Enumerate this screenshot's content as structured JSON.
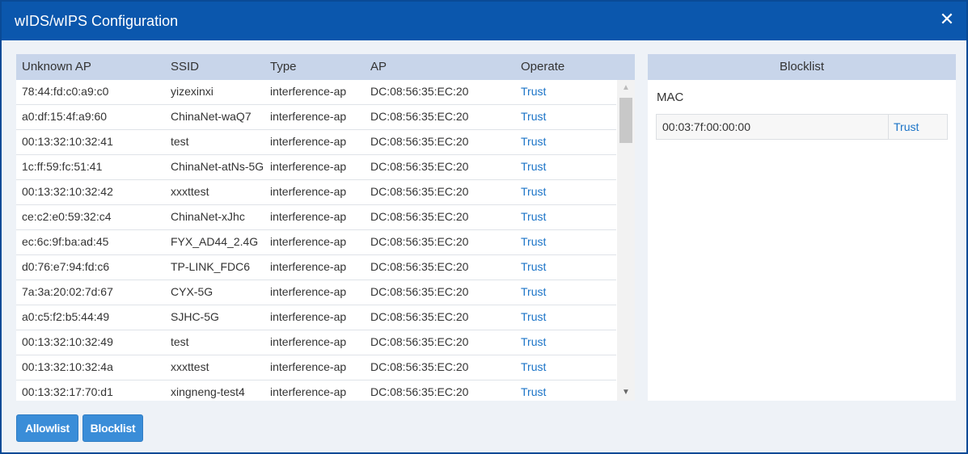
{
  "dialog": {
    "title": "wIDS/wIPS Configuration",
    "close_icon": "close-icon"
  },
  "table": {
    "columns": [
      "Unknown AP",
      "SSID",
      "Type",
      "AP",
      "Operate"
    ],
    "rows": [
      {
        "mac": "78:44:fd:c0:a9:c0",
        "ssid": "yizexinxi",
        "type": "interference-ap",
        "ap": "DC:08:56:35:EC:20",
        "operate": "Trust"
      },
      {
        "mac": "a0:df:15:4f:a9:60",
        "ssid": "ChinaNet-waQ7",
        "type": "interference-ap",
        "ap": "DC:08:56:35:EC:20",
        "operate": "Trust"
      },
      {
        "mac": "00:13:32:10:32:41",
        "ssid": "test",
        "type": "interference-ap",
        "ap": "DC:08:56:35:EC:20",
        "operate": "Trust"
      },
      {
        "mac": "1c:ff:59:fc:51:41",
        "ssid": "ChinaNet-atNs-5G",
        "type": "interference-ap",
        "ap": "DC:08:56:35:EC:20",
        "operate": "Trust"
      },
      {
        "mac": "00:13:32:10:32:42",
        "ssid": "xxxttest",
        "type": "interference-ap",
        "ap": "DC:08:56:35:EC:20",
        "operate": "Trust"
      },
      {
        "mac": "ce:c2:e0:59:32:c4",
        "ssid": "ChinaNet-xJhc",
        "type": "interference-ap",
        "ap": "DC:08:56:35:EC:20",
        "operate": "Trust"
      },
      {
        "mac": "ec:6c:9f:ba:ad:45",
        "ssid": "FYX_AD44_2.4G",
        "type": "interference-ap",
        "ap": "DC:08:56:35:EC:20",
        "operate": "Trust"
      },
      {
        "mac": "d0:76:e7:94:fd:c6",
        "ssid": "TP-LINK_FDC6",
        "type": "interference-ap",
        "ap": "DC:08:56:35:EC:20",
        "operate": "Trust"
      },
      {
        "mac": "7a:3a:20:02:7d:67",
        "ssid": "CYX-5G",
        "type": "interference-ap",
        "ap": "DC:08:56:35:EC:20",
        "operate": "Trust"
      },
      {
        "mac": "a0:c5:f2:b5:44:49",
        "ssid": "SJHC-5G",
        "type": "interference-ap",
        "ap": "DC:08:56:35:EC:20",
        "operate": "Trust"
      },
      {
        "mac": "00:13:32:10:32:49",
        "ssid": "test",
        "type": "interference-ap",
        "ap": "DC:08:56:35:EC:20",
        "operate": "Trust"
      },
      {
        "mac": "00:13:32:10:32:4a",
        "ssid": "xxxttest",
        "type": "interference-ap",
        "ap": "DC:08:56:35:EC:20",
        "operate": "Trust"
      },
      {
        "mac": "00:13:32:17:70:d1",
        "ssid": "xingneng-test4",
        "type": "interference-ap",
        "ap": "DC:08:56:35:EC:20",
        "operate": "Trust"
      }
    ]
  },
  "blocklist": {
    "header": "Blocklist",
    "mac_label": "MAC",
    "items": [
      {
        "mac": "00:03:7f:00:00:00",
        "action": "Trust"
      }
    ]
  },
  "buttons": {
    "allowlist": "Allowlist",
    "blocklist": "Blocklist"
  },
  "colors": {
    "titlebar": "#0b57ad",
    "header_bg": "#c8d5ea",
    "link": "#1a73c7",
    "button": "#3a8dd8"
  }
}
